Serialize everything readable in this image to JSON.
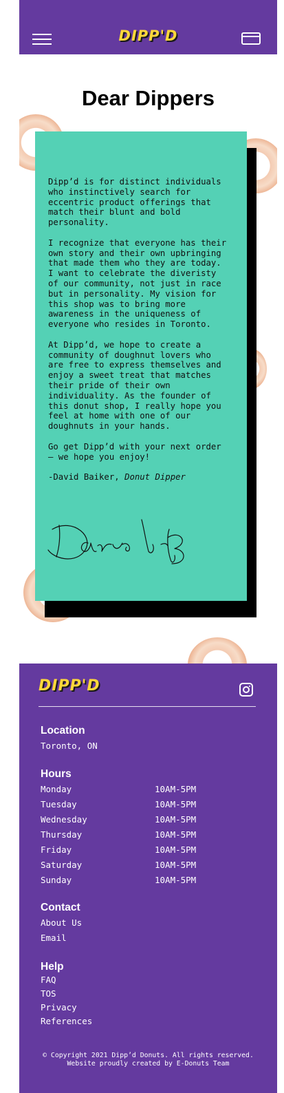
{
  "header": {
    "logo": "DIPP'D",
    "menu_icon": "hamburger-menu-icon",
    "cart_icon": "credit-card-icon",
    "background": "#643a9f",
    "logo_color": "#ffd83a"
  },
  "page": {
    "title": "Dear Dippers"
  },
  "letter": {
    "background": "#54d1b5",
    "paragraphs": [
      "Dipp’d is for distinct individuals\nwho instinctively search for\neccentric product offerings that\nmatch their blunt and bold\npersonality.",
      "I recognize that everyone has their\nown story and their own upbringing\nthat made them who they are today.\nI want to celebrate the diveristy\nof our community, not just in race\nbut in personality. My vision for\nthis shop was to bring more\nawareness in the uniqueness of\neveryone who resides in Toronto.",
      "At Dipp’d, we hope to create a\ncommunity of doughnut lovers who\nare free to express themselves and\nenjoy a sweet treat that matches\ntheir pride of their own\nindividuality. As the founder of\nthis donut shop, I really hope you\nfeel at home with one of our\ndoughnuts in your hands.",
      "Go get Dipp’d with your next order\n— we hope you enjoy!"
    ],
    "signoff_name": "-David Baiker, ",
    "signoff_title": "Donut Dipper"
  },
  "footer": {
    "logo": "DIPP'D",
    "social_icon": "instagram-icon",
    "location_heading": "Location",
    "location": "Toronto, ON",
    "hours_heading": "Hours",
    "hours": [
      {
        "day": "Monday",
        "time": "10AM-5PM"
      },
      {
        "day": "Tuesday",
        "time": "10AM-5PM"
      },
      {
        "day": "Wednesday",
        "time": "10AM-5PM"
      },
      {
        "day": "Thursday",
        "time": "10AM-5PM"
      },
      {
        "day": "Friday",
        "time": "10AM-5PM"
      },
      {
        "day": "Saturday",
        "time": "10AM-5PM"
      },
      {
        "day": "Sunday",
        "time": "10AM-5PM"
      }
    ],
    "contact_heading": "Contact",
    "contact_links": [
      "About Us",
      "Email"
    ],
    "help_heading": "Help",
    "help_links": [
      "FAQ",
      "TOS",
      "Privacy",
      "References"
    ],
    "copyright_line1": "© Copyright 2021 Dipp’d Donuts. All rights reserved.",
    "copyright_line2": "Website proudly created by E-Donuts Team"
  }
}
